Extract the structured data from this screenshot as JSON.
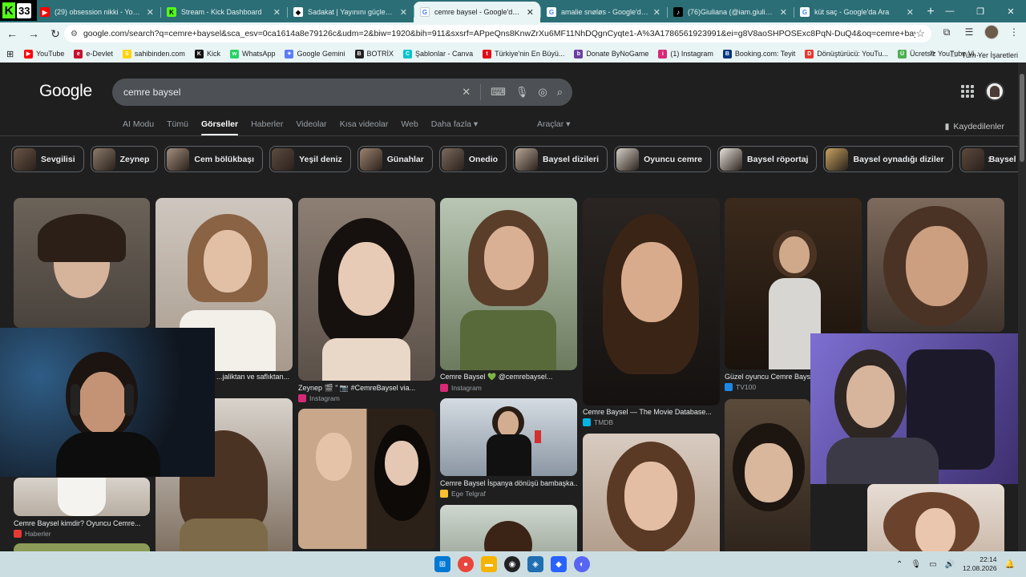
{
  "browser": {
    "tabs": [
      {
        "title": "(29) obsession nikki - YouTube",
        "fav": "yt"
      },
      {
        "title": "Stream - Kick Dashboard",
        "fav": "kick"
      },
      {
        "title": "Sadakat | Yayınını güçlendirmek",
        "fav": "sad"
      },
      {
        "title": "cemre baysel - Google'da Ara",
        "fav": "g",
        "active": true
      },
      {
        "title": "amalie snøløs - Google'da Ara",
        "fav": "g"
      },
      {
        "title": "(76)Giuliana (@iam.giuliana) | T",
        "fav": "tt"
      },
      {
        "title": "küt saç - Google'da Ara",
        "fav": "g"
      }
    ],
    "kick_badge": "33",
    "url": "google.com/search?q=cemre+baysel&sca_esv=0ca1614a8e79126c&udm=2&biw=1920&bih=911&sxsrf=APpeQns8KnwZrXu6MF11NhDQgnCyqte1-A%3A1786561923991&ei=g8V8aoSHPOSExc8PqN-DuQ4&oq=cemre+baysa&gs_lp=Egtnd3Mtd2l6...",
    "bookmarks": [
      {
        "label": "YouTube",
        "color": "#ff0000",
        "glyph": "▶"
      },
      {
        "label": "e-Devlet",
        "color": "#c8102e",
        "glyph": "e"
      },
      {
        "label": "sahibinden.com",
        "color": "#ffd400",
        "glyph": "S"
      },
      {
        "label": "Kick",
        "color": "#111111",
        "glyph": "K"
      },
      {
        "label": "WhatsApp",
        "color": "#25d366",
        "glyph": "w"
      },
      {
        "label": "Google Gemini",
        "color": "#5b7cf7",
        "glyph": "✦"
      },
      {
        "label": "BOTRİX",
        "color": "#222222",
        "glyph": "B"
      },
      {
        "label": "Şablonlar - Canva",
        "color": "#00c4cc",
        "glyph": "C"
      },
      {
        "label": "Türkiye'nin En Büyü...",
        "color": "#e30a17",
        "glyph": "t"
      },
      {
        "label": "Donate ByNoGame",
        "color": "#6b3fa0",
        "glyph": "b"
      },
      {
        "label": "(1) Instagram",
        "color": "#d62976",
        "glyph": "i"
      },
      {
        "label": "Booking.com: Teyit",
        "color": "#003580",
        "glyph": "B"
      },
      {
        "label": "Dönüştürücü: YouTu...",
        "color": "#e53935",
        "glyph": "D"
      },
      {
        "label": "Ücretsiz YouTube Vi...",
        "color": "#4caf50",
        "glyph": "Ü"
      }
    ],
    "more_bookmarks": "»",
    "all_bookmarks": "Tüm Yer İşaretleri"
  },
  "google": {
    "logo": "Google",
    "query": "cemre baysel",
    "nav": [
      "AI Modu",
      "Tümü",
      "Görseller",
      "Haberler",
      "Videolar",
      "Kısa videolar",
      "Web",
      "Daha fazla ▾"
    ],
    "active_nav": "Görseller",
    "tools": "Araçlar ▾",
    "saved": "Kaydedilenler",
    "chips": [
      "Sevgilisi",
      "Zeynep",
      "Cem bölükbaşı",
      "Yeşil deniz",
      "Günahlar",
      "Onedio",
      "Baysel dizileri",
      "Oyuncu cemre",
      "Baysel röportaj",
      "Baysel oynadığı diziler",
      "Baysel kimdir"
    ],
    "results": [
      {
        "caption": "...jaliktan ve saflıktan...",
        "source": ""
      },
      {
        "caption": "Zeynep 🎬 \" 📷 #CemreBaysel via...",
        "source": "Instagram"
      },
      {
        "caption": "Cemre Baysel 💚 @cemrebaysel...",
        "source": "Instagram"
      },
      {
        "caption": "Cemre Baysel — The Movie Database...",
        "source": "TMDB"
      },
      {
        "caption": "Güzel oyuncu Cemre Baysel...",
        "source": "TV100"
      },
      {
        "caption": "Cemre Baysel kimdir? Oyuncu Cemre...",
        "source": "Haberler"
      },
      {
        "caption": "Cemre Baysel İspanya dönüşü bambaşka...",
        "source": "Ege Telgraf"
      }
    ]
  },
  "taskbar": {
    "time": "22:14",
    "date": "12.08.2026"
  }
}
